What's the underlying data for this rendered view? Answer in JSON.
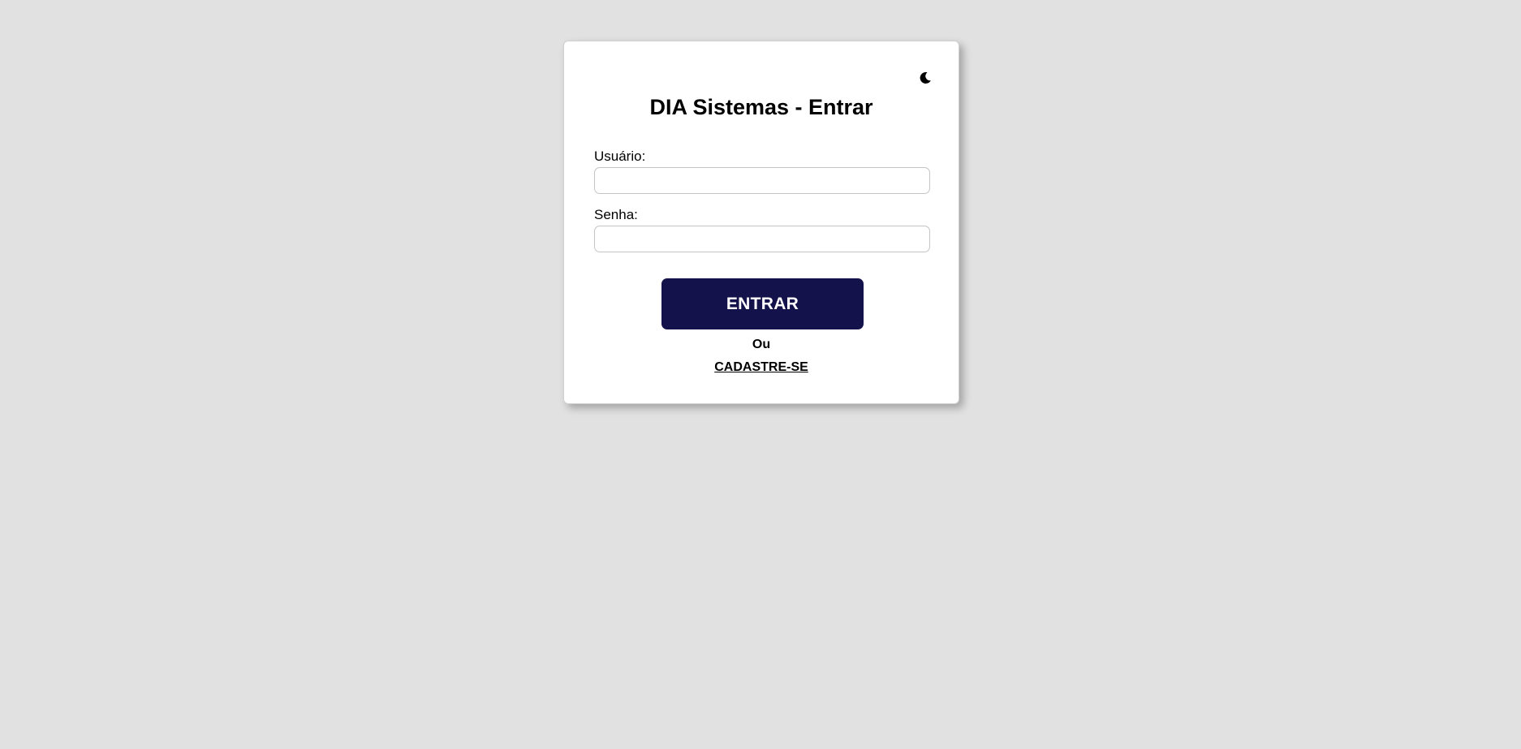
{
  "login": {
    "title": "DIA Sistemas - Entrar",
    "theme_toggle_icon": "moon-icon",
    "username_label": "Usuário:",
    "username_value": "",
    "password_label": "Senha:",
    "password_value": "",
    "submit_label": "ENTRAR",
    "separator_text": "Ou",
    "signup_label": "CADASTRE-SE"
  },
  "colors": {
    "background": "#e1e1e1",
    "card": "#ffffff",
    "button": "#14124a",
    "button_text": "#ffffff"
  }
}
